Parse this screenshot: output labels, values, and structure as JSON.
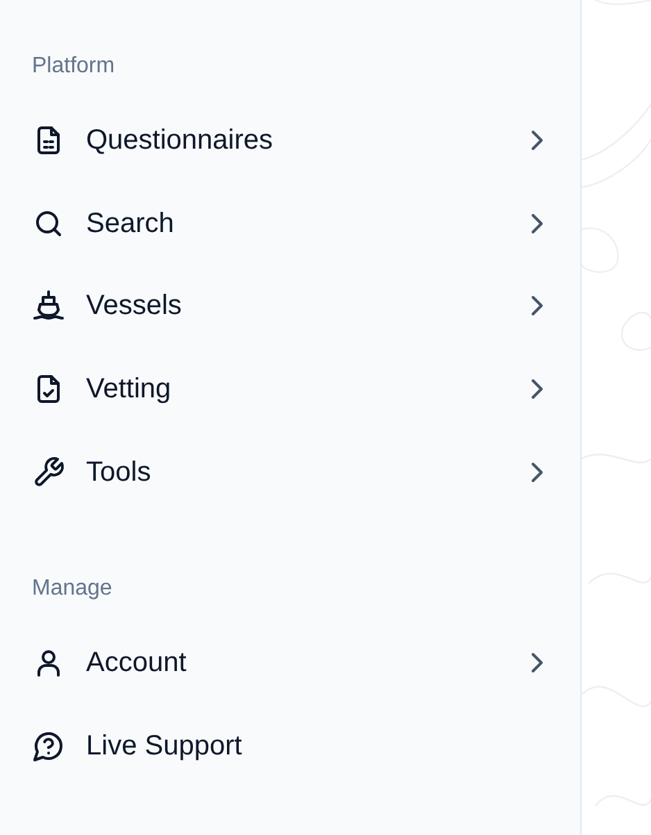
{
  "sidebar": {
    "sections": [
      {
        "title": "Platform",
        "items": [
          {
            "label": "Questionnaires",
            "expandable": true
          },
          {
            "label": "Search",
            "expandable": true
          },
          {
            "label": "Vessels",
            "expandable": true
          },
          {
            "label": "Vetting",
            "expandable": true
          },
          {
            "label": "Tools",
            "expandable": true
          }
        ]
      },
      {
        "title": "Manage",
        "items": [
          {
            "label": "Account",
            "expandable": true
          },
          {
            "label": "Live Support",
            "expandable": false
          }
        ]
      }
    ]
  }
}
